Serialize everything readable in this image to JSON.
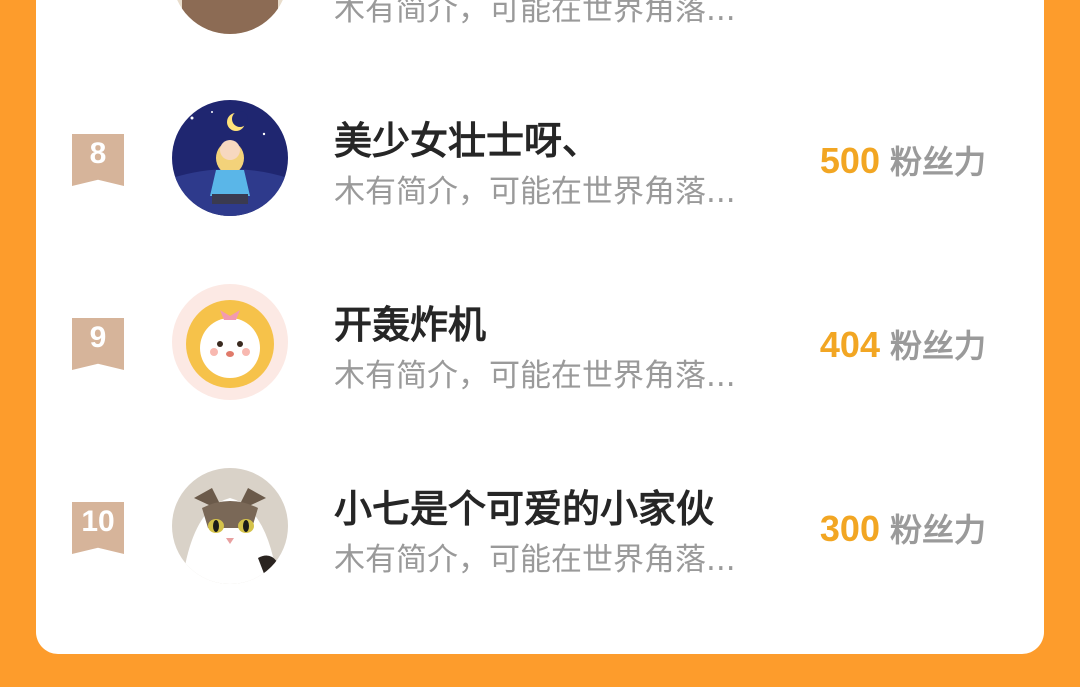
{
  "colors": {
    "page_background": "#FD9C2C",
    "card_background": "#FFFFFF",
    "fans_accent": "#F2A623",
    "badge": "#D6B49A"
  },
  "leaderboard": {
    "partial_top_row": {
      "bio": "木有简介，可能在世界角落..."
    },
    "rows": [
      {
        "rank": "8",
        "name": "美少女壮士呀、",
        "bio": "木有简介，可能在世界角落...",
        "fans_count": "500",
        "fans_label": "粉丝力",
        "avatar": "anime-girl-moon-avatar"
      },
      {
        "rank": "9",
        "name": "开轰炸机",
        "bio": "木有简介，可能在世界角落...",
        "fans_count": "404",
        "fans_label": "粉丝力",
        "avatar": "cartoon-bear-avatar"
      },
      {
        "rank": "10",
        "name": "小七是个可爱的小家伙",
        "bio": "木有简介，可能在世界角落...",
        "fans_count": "300",
        "fans_label": "粉丝力",
        "avatar": "kitten-photo-avatar"
      }
    ]
  }
}
